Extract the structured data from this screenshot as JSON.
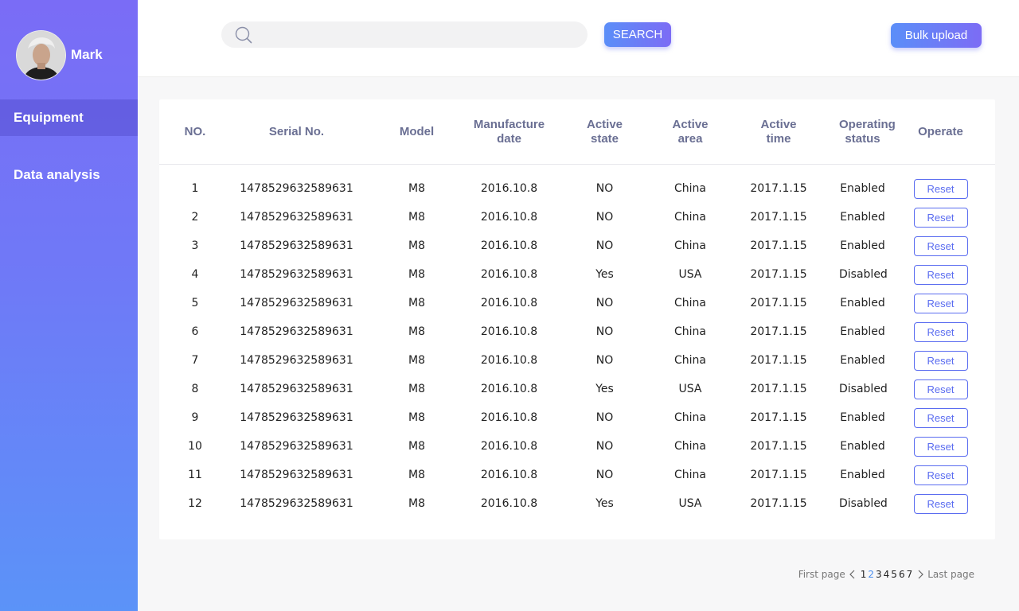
{
  "sidebar": {
    "username": "Mark",
    "items": [
      {
        "label": "Equipment",
        "active": true
      },
      {
        "label": "Data analysis",
        "active": false
      }
    ],
    "gradient": [
      "#7a6cf6",
      "#5b93f8"
    ]
  },
  "topbar": {
    "search_placeholder": "",
    "search_label": "SEARCH",
    "upload_label": "Bulk upload"
  },
  "table": {
    "headers": {
      "no": "NO.",
      "serial": "Serial No.",
      "model": "Model",
      "manufacture_1": "Manufacture",
      "manufacture_2": "date",
      "active_state_1": "Active",
      "active_state_2": "state",
      "active_area_1": "Active",
      "active_area_2": "area",
      "active_time_1": "Active",
      "active_time_2": "time",
      "operating_1": "Operating",
      "operating_2": "status",
      "operate": "Operate"
    },
    "rows": [
      {
        "no": "1",
        "serial": "1478529632589631",
        "model": "M8",
        "date": "2016.10.8",
        "state": "NO",
        "area": "China",
        "time": "2017.1.15",
        "status": "Enabled",
        "action": "Reset"
      },
      {
        "no": "2",
        "serial": "1478529632589631",
        "model": "M8",
        "date": "2016.10.8",
        "state": "NO",
        "area": "China",
        "time": "2017.1.15",
        "status": "Enabled",
        "action": "Reset"
      },
      {
        "no": "3",
        "serial": "1478529632589631",
        "model": "M8",
        "date": "2016.10.8",
        "state": "NO",
        "area": "China",
        "time": "2017.1.15",
        "status": "Enabled",
        "action": "Reset"
      },
      {
        "no": "4",
        "serial": "1478529632589631",
        "model": "M8",
        "date": "2016.10.8",
        "state": "Yes",
        "area": "USA",
        "time": "2017.1.15",
        "status": "Disabled",
        "action": "Reset"
      },
      {
        "no": "5",
        "serial": "1478529632589631",
        "model": "M8",
        "date": "2016.10.8",
        "state": "NO",
        "area": "China",
        "time": "2017.1.15",
        "status": "Enabled",
        "action": "Reset"
      },
      {
        "no": "6",
        "serial": "1478529632589631",
        "model": "M8",
        "date": "2016.10.8",
        "state": "NO",
        "area": "China",
        "time": "2017.1.15",
        "status": "Enabled",
        "action": "Reset"
      },
      {
        "no": "7",
        "serial": "1478529632589631",
        "model": "M8",
        "date": "2016.10.8",
        "state": "NO",
        "area": "China",
        "time": "2017.1.15",
        "status": "Enabled",
        "action": "Reset"
      },
      {
        "no": "8",
        "serial": "1478529632589631",
        "model": "M8",
        "date": "2016.10.8",
        "state": "Yes",
        "area": "USA",
        "time": "2017.1.15",
        "status": "Disabled",
        "action": "Reset"
      },
      {
        "no": "9",
        "serial": "1478529632589631",
        "model": "M8",
        "date": "2016.10.8",
        "state": "NO",
        "area": "China",
        "time": "2017.1.15",
        "status": "Enabled",
        "action": "Reset"
      },
      {
        "no": "10",
        "serial": "1478529632589631",
        "model": "M8",
        "date": "2016.10.8",
        "state": "NO",
        "area": "China",
        "time": "2017.1.15",
        "status": "Enabled",
        "action": "Reset"
      },
      {
        "no": "11",
        "serial": "1478529632589631",
        "model": "M8",
        "date": "2016.10.8",
        "state": "NO",
        "area": "China",
        "time": "2017.1.15",
        "status": "Enabled",
        "action": "Reset"
      },
      {
        "no": "12",
        "serial": "1478529632589631",
        "model": "M8",
        "date": "2016.10.8",
        "state": "Yes",
        "area": "USA",
        "time": "2017.1.15",
        "status": "Disabled",
        "action": "Reset"
      }
    ]
  },
  "pagination": {
    "first_label": "First page",
    "last_label": "Last page",
    "pages": [
      "1",
      "2",
      "3",
      "4",
      "5",
      "6",
      "7"
    ],
    "current": "2"
  },
  "colors": {
    "accent": "#5a6cf0",
    "header_text": "#6a6f93",
    "current_page": "#4a8ef0"
  }
}
